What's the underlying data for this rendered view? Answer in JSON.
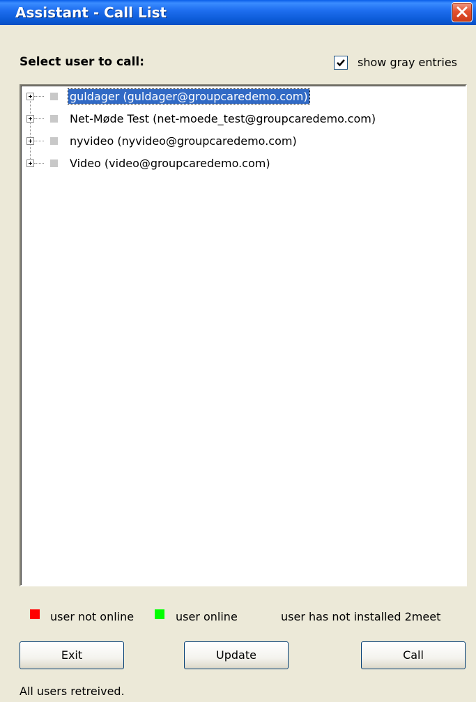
{
  "window": {
    "title": "Assistant - Call List"
  },
  "prompt": "Select user to call:",
  "show_gray": {
    "label": "show gray entries",
    "checked": true
  },
  "entries": [
    {
      "label": "guldager (guldager@groupcaredemo.com)",
      "selected": true
    },
    {
      "label": "Net-Møde Test (net-moede_test@groupcaredemo.com)",
      "selected": false
    },
    {
      "label": "nyvideo (nyvideo@groupcaredemo.com)",
      "selected": false
    },
    {
      "label": "Video (video@groupcaredemo.com)",
      "selected": false
    }
  ],
  "legend": {
    "not_online": {
      "label": "user not online",
      "color": "#ff0000"
    },
    "online": {
      "label": "user online",
      "color": "#00ff00"
    },
    "not_installed": {
      "label": "user has not installed 2meet"
    }
  },
  "buttons": {
    "exit": "Exit",
    "update": "Update",
    "call": "Call"
  },
  "status": "All users retreived."
}
